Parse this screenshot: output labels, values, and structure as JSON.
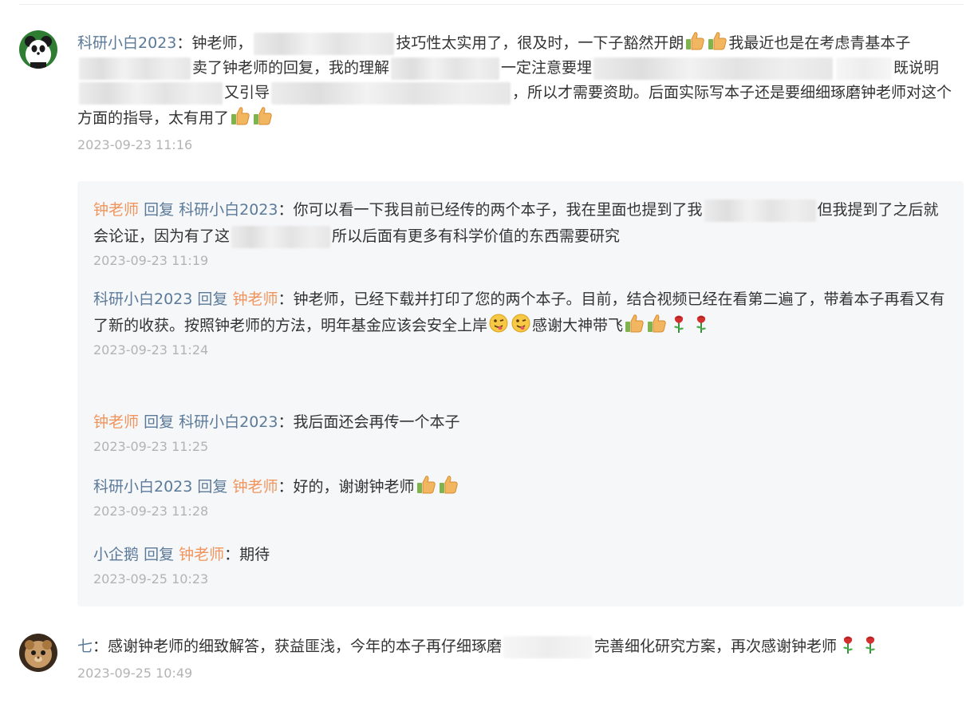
{
  "comments": [
    {
      "author": "科研小白2023",
      "sep": "：",
      "parts": [
        "钟老师，",
        "技巧性太实用了，很及时，一下子豁然开朗",
        "我最近也是在考虑青基本子",
        "卖了钟老师的回复，我的理解",
        "一定注意要埋",
        "既说明",
        "又引导",
        "，所以才需要资助。后面实际写本子还是要细细琢磨钟老师对这个方面的指导，太有用了"
      ],
      "time": "2023-09-23 11:16"
    },
    {
      "author": "七",
      "sep": "：",
      "parts": [
        "感谢钟老师的细致解答，获益匪浅，今年的本子再仔细琢磨",
        "完善细化研究方案，再次感谢钟老师"
      ],
      "time": "2023-09-25 10:49"
    }
  ],
  "reply_word": "回复",
  "replies": [
    {
      "author": "钟老师",
      "target": "科研小白2023",
      "parts": [
        "：你可以看一下我目前已经传的两个本子，我在里面也提到了我",
        "但我提到了之后就会论证，因为有了这",
        "所以后面有更多有科学价值的东西需要研究"
      ],
      "time": "2023-09-23 11:19"
    },
    {
      "author": "科研小白2023",
      "target": "钟老师",
      "parts": [
        "：钟老师，已经下载并打印了您的两个本子。目前，结合视频已经在看第二遍了，带着本子再看又有了新的收获。按照钟老师的方法，明年基金应该会安全上岸",
        "感谢大神带飞"
      ],
      "time": "2023-09-23 11:24"
    },
    {
      "author": "钟老师",
      "target": "科研小白2023",
      "parts": [
        "：我后面还会再传一个本子"
      ],
      "time": "2023-09-23 11:25"
    },
    {
      "author": "科研小白2023",
      "target": "钟老师",
      "parts": [
        "：好的，谢谢钟老师"
      ],
      "time": "2023-09-23 11:28"
    },
    {
      "author": "小企鹅",
      "target": "钟老师",
      "parts": [
        "：期待"
      ],
      "time": "2023-09-25 10:23"
    }
  ],
  "icons": {
    "thumbs_up": "thumbs-up-icon",
    "wink": "wink-tongue-icon",
    "rose": "rose-icon"
  },
  "colors": {
    "author": "#5b7a99",
    "teacher": "#f0955d",
    "time": "#b3b3b3",
    "reply_bg": "#f6f7f9"
  }
}
